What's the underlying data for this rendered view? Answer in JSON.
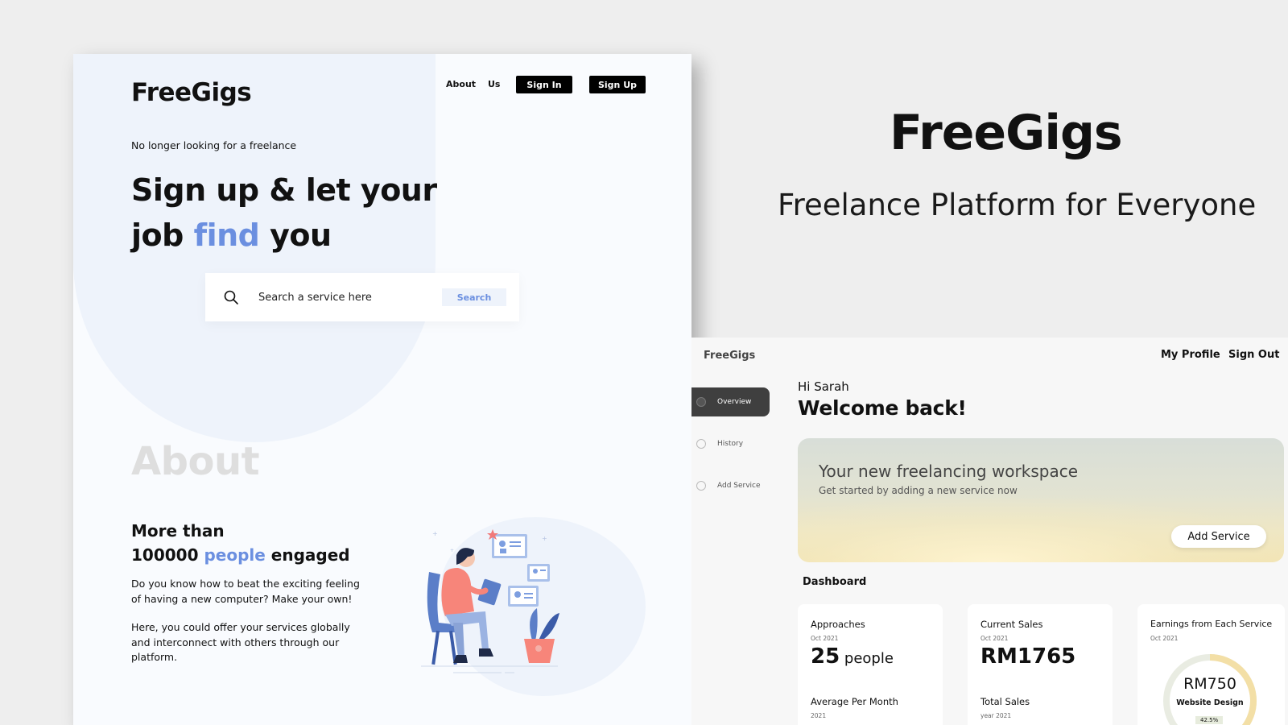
{
  "landing": {
    "logo": "FreeGigs",
    "nav": {
      "about": "About",
      "us": "Us",
      "sign_in": "Sign In",
      "sign_up": "Sign Up"
    },
    "tagline": "No longer looking for a freelance",
    "headline": {
      "line1": "Sign up & let your",
      "line2_a": "job ",
      "line2_highlight": "find",
      "line2_b": " you"
    },
    "search": {
      "placeholder": "Search a service here",
      "button": "Search"
    },
    "about": {
      "title": "About",
      "stat_line1": "More than",
      "stat_number": "100000 ",
      "stat_highlight": "people",
      "stat_tail": " engaged",
      "para1": "Do you know how to beat the exciting feeling of having a new computer? Make your own!",
      "para2": "Here, you could offer your services globally and interconnect with others through our platform."
    }
  },
  "hero": {
    "title": "FreeGigs",
    "subtitle": "Freelance Platform for Everyone"
  },
  "dashboard": {
    "logo": "FreeGigs",
    "nav": {
      "profile": "My Profile",
      "sign_out": "Sign Out"
    },
    "sidebar": [
      {
        "label": "Overview",
        "active": true,
        "icon": "overview-icon"
      },
      {
        "label": "History",
        "active": false,
        "icon": "history-icon"
      },
      {
        "label": "Add Service",
        "active": false,
        "icon": "add-service-icon"
      }
    ],
    "greeting": "Hi Sarah",
    "welcome": "Welcome back!",
    "banner": {
      "title": "Your new freelancing workspace",
      "subtitle": "Get started by adding a new service now",
      "button": "Add Service"
    },
    "section_label": "Dashboard",
    "cards": [
      {
        "title": "Approaches",
        "date": "Oct 2021",
        "value": "25",
        "unit": " people",
        "title2": "Average Per Month",
        "date2": "2021"
      },
      {
        "title": "Current Sales",
        "date": "Oct 2021",
        "value": "RM1765",
        "unit": "",
        "title2": "Total Sales",
        "date2": "year 2021"
      },
      {
        "title": "Earnings from Each Service",
        "date": "Oct 2021",
        "donut_value": "RM750",
        "donut_label": "Website Design",
        "donut_percent": "42.5%",
        "donut_fraction": 0.425
      }
    ],
    "colors": {
      "accent": "#6b8fe0",
      "dark": "#000000",
      "donut": "#f3dfa6",
      "donut_track": "#e9ece2"
    }
  }
}
